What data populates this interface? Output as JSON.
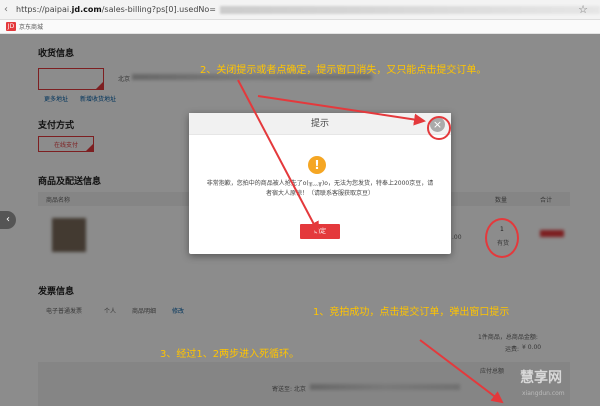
{
  "browser": {
    "url_prefix": "https://paipai.",
    "url_domain": "jd.com",
    "url_suffix": "/sales-billing?ps[0].usedNo=",
    "bookmark_label": "京东商城",
    "bookmark_logo": "JD"
  },
  "page": {
    "shipping_title": "收货信息",
    "address_city": "北京",
    "more_address_link": "更多地址",
    "add_address_link": "新增收货地址",
    "payment_title": "支付方式",
    "payment_option": "在线支付",
    "goods_title": "商品及配送信息",
    "goods_col_name": "商品名称",
    "goods_col_qty": "数量",
    "goods_col_total": "合计",
    "goods_price": ".00",
    "qty_value": "1",
    "qty_status": "有货",
    "invoice_title": "发票信息",
    "invoice_types": [
      "电子普通发票",
      "个人",
      "商品明细",
      "修改"
    ],
    "summary_count": "1件商品，总商品金额:",
    "summary_freight_label": "运费:",
    "summary_freight_value": "¥ 0.00",
    "pay_total_label": "应付总额",
    "deliver_to": "寄送至: 北京"
  },
  "modal": {
    "title": "提示",
    "close": "×",
    "warn_icon": "!",
    "message": "非常抱歉，您拍中的商品被人抢先了o(╥﹏╥)o，无法为您发货，特奉上2000京豆，请者宿大人原谅！（请联系客服获取京豆）",
    "ok_label": "确定"
  },
  "annotations": {
    "note1": "1、竞拍成功，点击提交订单，弹出窗口提示",
    "note2": "2、关闭提示或者点确定，提示窗口消失，又只能点击提交订单。",
    "note3": "3、经过1、2两步进入死循环。"
  },
  "watermark": {
    "text": "慧享网",
    "sub": "xiangdun.com"
  },
  "colors": {
    "accent_red": "#e4393c",
    "annotation_yellow": "#ffc400",
    "link_blue": "#005ea7"
  }
}
